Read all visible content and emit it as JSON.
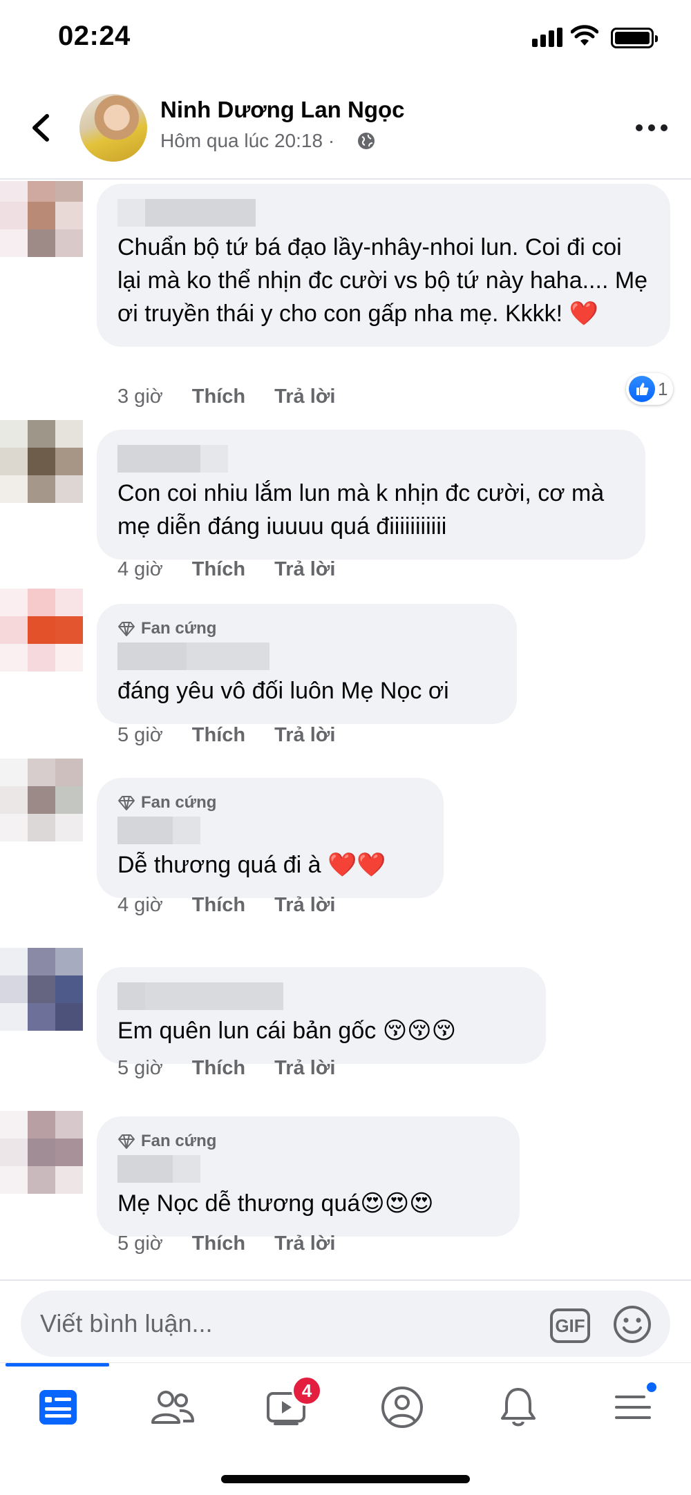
{
  "status_bar": {
    "time": "02:24"
  },
  "post_header": {
    "author": "Ninh Dương Lan Ngọc",
    "timestamp": "Hôm qua lúc 20:18",
    "separator": "·",
    "privacy_icon": "globe-icon"
  },
  "comments": [
    {
      "badge": "",
      "text": "Chuẩn bộ tứ bá đạo lầy-nhây-nhoi lun. Coi đi coi lại mà ko thể nhịn đc cười vs bộ tứ này haha.... Mẹ ơi truyền thái y cho con gấp nha mẹ. Kkkk! ❤️",
      "time": "3 giờ",
      "like": "Thích",
      "reply": "Trả lời",
      "reaction_count": "1"
    },
    {
      "badge": "",
      "text": "Con coi nhiu lắm lun mà k nhịn đc cười, cơ mà mẹ diễn đáng iuuuu quá điiiiiiiiiii",
      "time": "4 giờ",
      "like": "Thích",
      "reply": "Trả lời"
    },
    {
      "badge": "Fan cứng",
      "text": "đáng yêu vô đối luôn Mẹ Nọc ơi",
      "time": "5 giờ",
      "like": "Thích",
      "reply": "Trả lời"
    },
    {
      "badge": "Fan cứng",
      "text": "Dễ thương quá đi à ❤️❤️",
      "time": "4 giờ",
      "like": "Thích",
      "reply": "Trả lời"
    },
    {
      "badge": "",
      "text": "Em quên lun cái bản gốc 😚😚😚",
      "time": "5 giờ",
      "like": "Thích",
      "reply": "Trả lời"
    },
    {
      "badge": "Fan cứng",
      "text": "Mẹ Nọc dễ thương quá😍😍😍",
      "time": "5 giờ",
      "like": "Thích",
      "reply": "Trả lời"
    }
  ],
  "composer": {
    "placeholder": "Viết bình luận...",
    "gif_label": "GIF"
  },
  "bottom_nav": {
    "items": [
      "news-feed-icon",
      "friends-icon",
      "watch-icon",
      "profile-icon",
      "notifications-icon",
      "menu-icon"
    ],
    "watch_badge": "4"
  },
  "colors": {
    "accent": "#0866ff",
    "badge_red": "#e41e3f",
    "bubble": "#f0f2f5",
    "secondary_text": "#65676b"
  }
}
